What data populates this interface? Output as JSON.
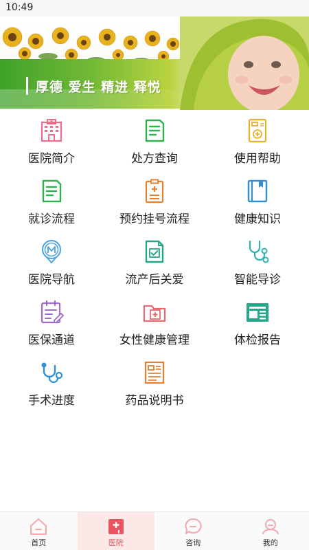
{
  "status_bar": {
    "time": "10:49"
  },
  "banner": {
    "slogan": "厚德 爱生 精进 释悦"
  },
  "menu": {
    "items": [
      {
        "label": "医院简介",
        "icon": "hospital-building-icon",
        "color": "#f06b8a"
      },
      {
        "label": "处方查询",
        "icon": "prescription-doc-icon",
        "color": "#2fb14f"
      },
      {
        "label": "使用帮助",
        "icon": "calculator-help-icon",
        "color": "#e7b12d"
      },
      {
        "label": "就诊流程",
        "icon": "visit-flow-doc-icon",
        "color": "#2fb14f"
      },
      {
        "label": "预约挂号流程",
        "icon": "clipboard-cross-icon",
        "color": "#e87f2f"
      },
      {
        "label": "健康知识",
        "icon": "book-icon",
        "color": "#2f8fd6"
      },
      {
        "label": "医院导航",
        "icon": "map-pin-m-icon",
        "color": "#4aa3e0"
      },
      {
        "label": "流产后关爱",
        "icon": "doc-check-icon",
        "color": "#24a889"
      },
      {
        "label": "智能导诊",
        "icon": "stethoscope-icon",
        "color": "#2fb3b0"
      },
      {
        "label": "医保通道",
        "icon": "calendar-edit-icon",
        "color": "#9b6cc9"
      },
      {
        "label": "女性健康管理",
        "icon": "folder-cross-icon",
        "color": "#e8696f"
      },
      {
        "label": "体检报告",
        "icon": "newspaper-icon",
        "color": "#24a889"
      },
      {
        "label": "手术进度",
        "icon": "stethoscope-blue-icon",
        "color": "#2f8fd6"
      },
      {
        "label": "药品说明书",
        "icon": "drug-instruction-icon",
        "color": "#e87f2f"
      }
    ]
  },
  "tabbar": {
    "items": [
      {
        "label": "首页",
        "icon": "home-icon",
        "active": false
      },
      {
        "label": "医院",
        "icon": "hospital-icon",
        "active": true
      },
      {
        "label": "咨询",
        "icon": "chat-icon",
        "active": false
      },
      {
        "label": "我的",
        "icon": "user-icon",
        "active": false
      }
    ]
  }
}
